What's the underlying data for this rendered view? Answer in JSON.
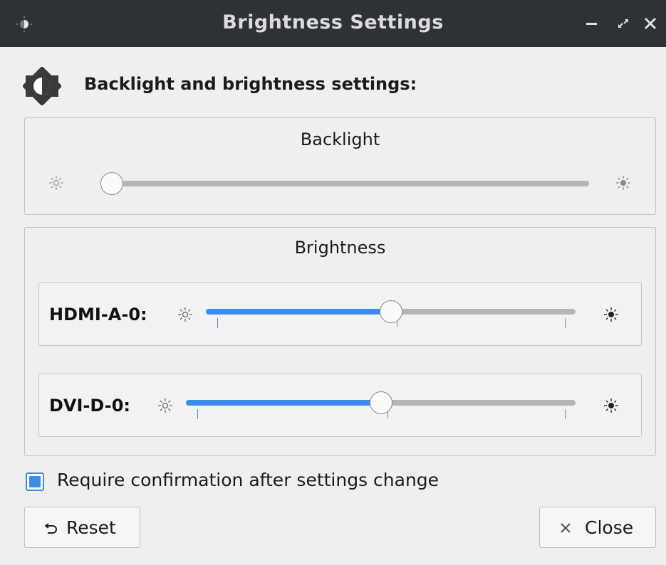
{
  "window": {
    "title": "Brightness Settings",
    "icon": "brightness-icon",
    "controls": [
      "minimize-icon",
      "maximize-icon",
      "close-icon"
    ]
  },
  "header": {
    "icon": "brightness-contrast-icon",
    "text": "Backlight and brightness settings:"
  },
  "backlight": {
    "title": "Backlight",
    "value_fraction": 0.0,
    "min_icon": "sun-dim-icon",
    "max_icon": "sun-bright-icon"
  },
  "brightness": {
    "title": "Brightness",
    "outputs": [
      {
        "label": "HDMI-A-0:",
        "value_fraction": 0.5,
        "min_icon": "sun-dim-icon",
        "max_icon": "sun-bright-icon"
      },
      {
        "label": "DVI-D-0:",
        "value_fraction": 0.5,
        "min_icon": "sun-dim-icon",
        "max_icon": "sun-bright-icon"
      }
    ]
  },
  "confirm": {
    "label": "Require confirmation after settings change",
    "checked": true
  },
  "buttons": {
    "reset_label": "Reset",
    "reset_icon": "undo-icon",
    "close_label": "Close",
    "close_icon": "close-icon"
  },
  "colors": {
    "titlebar": "#2e3135",
    "accent": "#3b8ee8",
    "background": "#efefef"
  }
}
